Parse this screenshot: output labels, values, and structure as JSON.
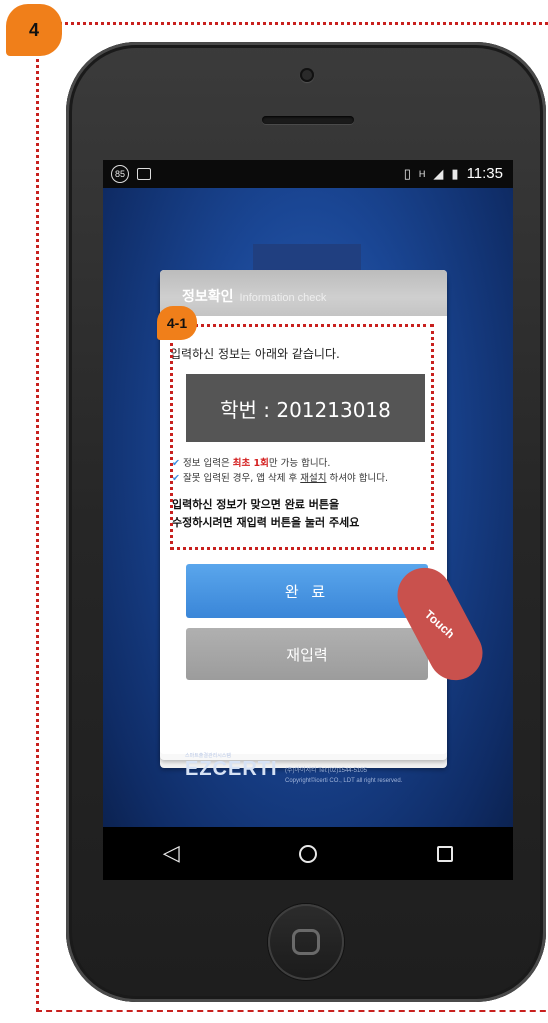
{
  "annotation": {
    "step_label": "4",
    "sub_step_label": "4-1",
    "touch_label": "Touch"
  },
  "statusbar": {
    "badge_number": "85",
    "time": "11:35",
    "signal_label": "H"
  },
  "dialog": {
    "title": "정보확인",
    "title_en": "Information check",
    "intro": "입력하신 정보는 아래와 같습니다.",
    "id_display": "학번 : 201213018",
    "notes": {
      "line1_pre": "정보 입력은 ",
      "line1_hl": "최초 1회",
      "line1_post": "만 가능 합니다.",
      "line2_pre": "잘못 입력된 경우, 앱 삭제 후 ",
      "line2_ul": "재설치",
      "line2_post": " 하셔야 합니다."
    },
    "instruction_line1": "입력하신 정보가 맞으면 완료 버튼을",
    "instruction_line2": "수정하시려면 재입력 버튼을 눌러 주세요",
    "confirm_button": "완 료",
    "reenter_button": "재입력"
  },
  "footer": {
    "brand": "EZCERTI",
    "brand_small": "스마트출결관리시스템",
    "company": "(주)아이서티 Tel:(02)1544-5105",
    "copyright": "Copyright©icerti CO., LDT all right reserved."
  },
  "colors": {
    "annotation": "#c8201e",
    "badge": "#f07f1a",
    "confirm": "#4a97e3",
    "reenter": "#a6a6a6"
  }
}
